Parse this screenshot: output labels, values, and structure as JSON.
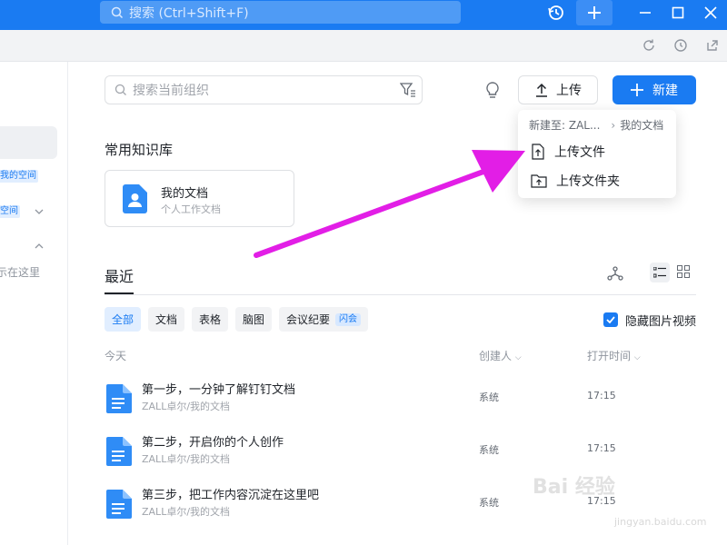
{
  "titlebar": {
    "search_placeholder": "搜索 (Ctrl+Shift+F)",
    "colors": {
      "bar": "#1a7bf2"
    }
  },
  "sidebar": {
    "tag_1": "我的空间",
    "tag_2": "空间",
    "text_1": "示在这里"
  },
  "toolbar": {
    "search_placeholder": "搜索当前组织",
    "upload_label": "上传",
    "new_label": "新建"
  },
  "upload_menu": {
    "path_prefix": "新建至: ZAL...",
    "path_folder": "我的文档",
    "items": [
      {
        "label": "上传文件"
      },
      {
        "label": "上传文件夹"
      }
    ]
  },
  "knowledge": {
    "section_title": "常用知识库",
    "card": {
      "name": "我的文档",
      "desc": "个人工作文档"
    }
  },
  "recent": {
    "tab_label": "最近",
    "filters": [
      {
        "label": "全部",
        "active": true
      },
      {
        "label": "文档"
      },
      {
        "label": "表格"
      },
      {
        "label": "脑图"
      },
      {
        "label": "会议纪要",
        "badge": "闪会"
      }
    ],
    "hide_media_label": "隐藏图片视频",
    "columns": {
      "group": "今天",
      "creator": "创建人",
      "opened": "打开时间"
    },
    "rows": [
      {
        "title": "第一步，一分钟了解钉钉文档",
        "path": "ZALL卓尔/我的文档",
        "creator": "系统",
        "time": "17:15"
      },
      {
        "title": "第二步，开启你的个人创作",
        "path": "ZALL卓尔/我的文档",
        "creator": "系统",
        "time": "17:15"
      },
      {
        "title": "第三步，把工作内容沉淀在这里吧",
        "path": "ZALL卓尔/我的文档",
        "creator": "系统",
        "time": "17:15"
      }
    ]
  },
  "watermark": {
    "main": "Bai 经验",
    "sub": "jingyan.baidu.com"
  },
  "colors": {
    "accent": "#1a7bf2",
    "arrow": "#e21ee6"
  }
}
